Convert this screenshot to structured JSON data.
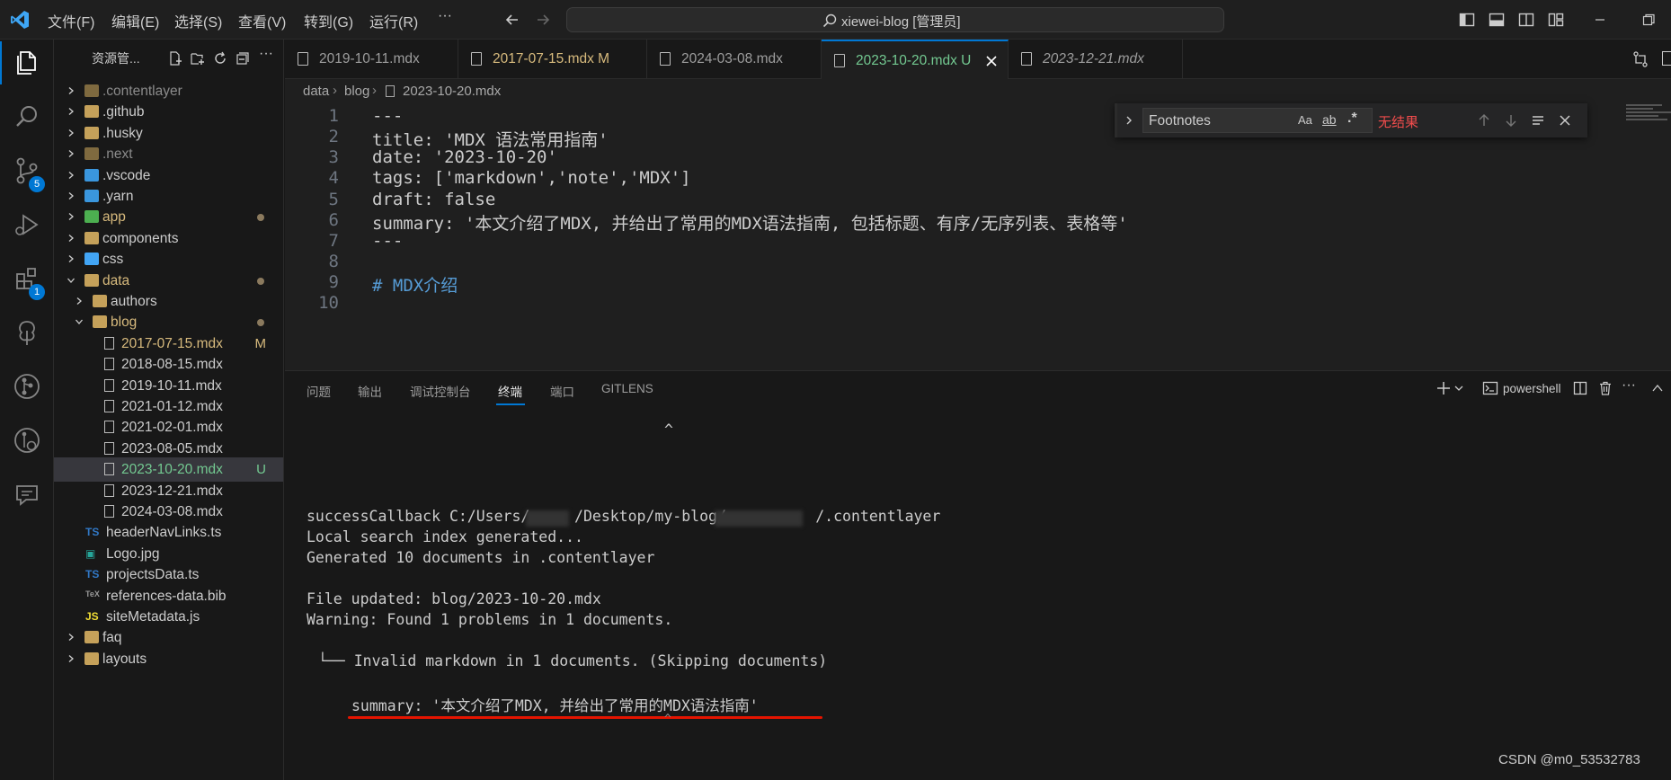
{
  "titlebar": {
    "menus": [
      "文件(F)",
      "编辑(E)",
      "选择(S)",
      "查看(V)",
      "转到(G)",
      "运行(R)",
      "···"
    ],
    "search_text": "xiewei-blog [管理员]",
    "icons": [
      "vscode-logo-icon",
      "arrow-left-icon",
      "arrow-right-icon",
      "toggle-sidebar-icon",
      "toggle-panel-icon",
      "toggle-secondary-sidebar-icon",
      "customize-layout-icon",
      "minimize-icon",
      "restore-icon"
    ]
  },
  "activity_bar": {
    "scm_badge": "5",
    "extensions_badge": "1"
  },
  "sidebar": {
    "title": "资源管...",
    "tree": [
      {
        "label": ".contentlayer",
        "type": "folder",
        "color": "#8b8b8b"
      },
      {
        "label": ".github",
        "type": "folder",
        "color": "#cccccc"
      },
      {
        "label": ".husky",
        "type": "folder",
        "color": "#cccccc"
      },
      {
        "label": ".next",
        "type": "folder",
        "color": "#8b8b8b"
      },
      {
        "label": ".vscode",
        "type": "folder",
        "color": "#cccccc"
      },
      {
        "label": ".yarn",
        "type": "folder",
        "color": "#cccccc"
      },
      {
        "label": "app",
        "type": "folder",
        "color": "#d7ba7d"
      },
      {
        "label": "components",
        "type": "folder",
        "color": "#cccccc"
      },
      {
        "label": "css",
        "type": "folder",
        "color": "#cccccc"
      },
      {
        "label": "data",
        "type": "folder-open",
        "color": "#d7ba7d"
      },
      {
        "label": "authors",
        "type": "folder",
        "color": "#cccccc"
      },
      {
        "label": "blog",
        "type": "folder-open",
        "color": "#d7ba7d"
      },
      {
        "label": "2017-07-15.mdx",
        "type": "file",
        "color": "#d7ba7d",
        "status": "M"
      },
      {
        "label": "2018-08-15.mdx",
        "type": "file",
        "color": "#cccccc"
      },
      {
        "label": "2019-10-11.mdx",
        "type": "file",
        "color": "#cccccc"
      },
      {
        "label": "2021-01-12.mdx",
        "type": "file",
        "color": "#cccccc"
      },
      {
        "label": "2021-02-01.mdx",
        "type": "file",
        "color": "#cccccc"
      },
      {
        "label": "2023-08-05.mdx",
        "type": "file",
        "color": "#cccccc"
      },
      {
        "label": "2023-10-20.mdx",
        "type": "file",
        "color": "#73c991",
        "status": "U"
      },
      {
        "label": "2023-12-21.mdx",
        "type": "file",
        "color": "#cccccc"
      },
      {
        "label": "2024-03-08.mdx",
        "type": "file",
        "color": "#cccccc"
      },
      {
        "label": "headerNavLinks.ts",
        "type": "ts",
        "color": "#cccccc"
      },
      {
        "label": "Logo.jpg",
        "type": "img",
        "color": "#cccccc"
      },
      {
        "label": "projectsData.ts",
        "type": "ts",
        "color": "#cccccc"
      },
      {
        "label": "references-data.bib",
        "type": "tex",
        "color": "#cccccc"
      },
      {
        "label": "siteMetadata.js",
        "type": "js",
        "color": "#cccccc"
      },
      {
        "label": "faq",
        "type": "folder",
        "color": "#cccccc"
      },
      {
        "label": "layouts",
        "type": "folder",
        "color": "#cccccc"
      }
    ]
  },
  "tabs": [
    {
      "label": "2019-10-11.mdx",
      "status": "",
      "color": "#9d9d9d"
    },
    {
      "label": "2017-07-15.mdx",
      "status": "M",
      "color": "#d7ba7d"
    },
    {
      "label": "2024-03-08.mdx",
      "status": "",
      "color": "#9d9d9d"
    },
    {
      "label": "2023-10-20.mdx",
      "status": "U",
      "color": "#73c991"
    },
    {
      "label": "2023-12-21.mdx",
      "status": "",
      "color": "#9d9d9d"
    }
  ],
  "breadcrumb": [
    "data",
    "blog",
    "2023-10-20.mdx"
  ],
  "editor": {
    "line_numbers": [
      "1",
      "2",
      "3",
      "4",
      "5",
      "6",
      "7",
      "8",
      "9",
      "10"
    ],
    "lines": [
      "---",
      "title: 'MDX 语法常用指南'",
      "date: '2023-10-20'",
      "tags: ['markdown','note','MDX']",
      "draft: false",
      "summary: '本文介绍了MDX, 并给出了常用的MDX语法指南, 包括标题、有序/无序列表、表格等'",
      "---",
      "",
      "# MDX介绍",
      ""
    ]
  },
  "find_widget": {
    "query": "Footnotes",
    "match_case": "Aa",
    "whole_word": "ab",
    "regex": ".*",
    "result": "无结果"
  },
  "panel": {
    "tabs": [
      "问题",
      "输出",
      "调试控制台",
      "终端",
      "端口",
      "GITLENS"
    ],
    "active_tab": "终端",
    "shell": "powershell",
    "terminal": {
      "caret1": "^",
      "line1": "successCallback C:/Users/     /Desktop/my-blog/          /.contentlayer",
      "line2": "Local search index generated...",
      "line3": "Generated 10 documents in .contentlayer",
      "line4": "File updated: blog/2023-10-20.mdx",
      "line5": "Warning: Found 1 problems in 1 documents.",
      "line6": "└── Invalid markdown in 1 documents. (Skipping documents)",
      "line7": "summary: '本文介绍了MDX, 并给出了常用的MDX语法指南'",
      "caret2": "^"
    }
  },
  "watermark": "CSDN @m0_53532783",
  "colors": {
    "accent": "#0078d4",
    "modified": "#d7ba7d",
    "untracked": "#73c991",
    "error": "#f14c4c",
    "underline": "#e51400"
  }
}
